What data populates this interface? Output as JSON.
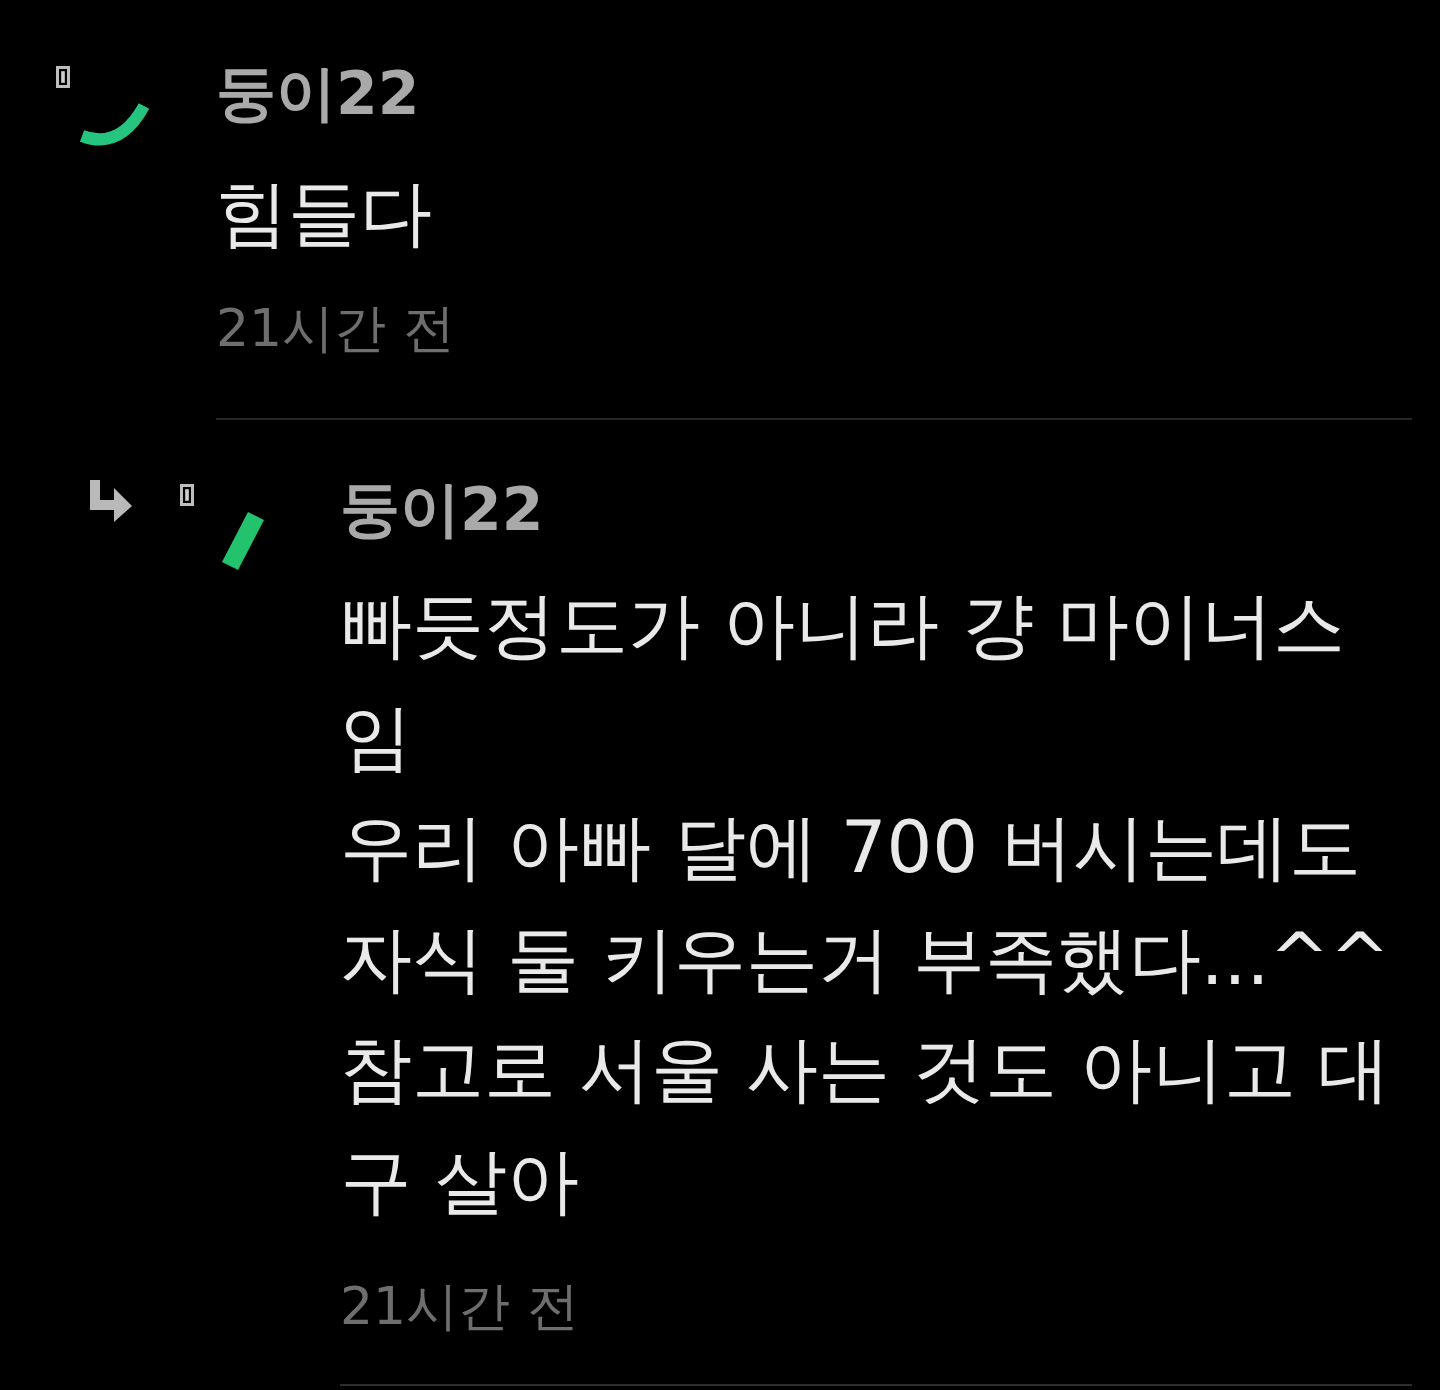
{
  "comments": [
    {
      "author": "둥이22",
      "body": "힘들다",
      "time": "21시간 전",
      "reply": false
    },
    {
      "author": "둥이22",
      "body": "빠듯정도가 아니라 걍 마이너스\n임\n우리 아빠 달에 700 버시는데도\n자식 둘 키우는거 부족했다...^^\n참고로 서울 사는 것도 아니고 대\n구 살아",
      "time": "21시간 전",
      "reply": true
    }
  ]
}
